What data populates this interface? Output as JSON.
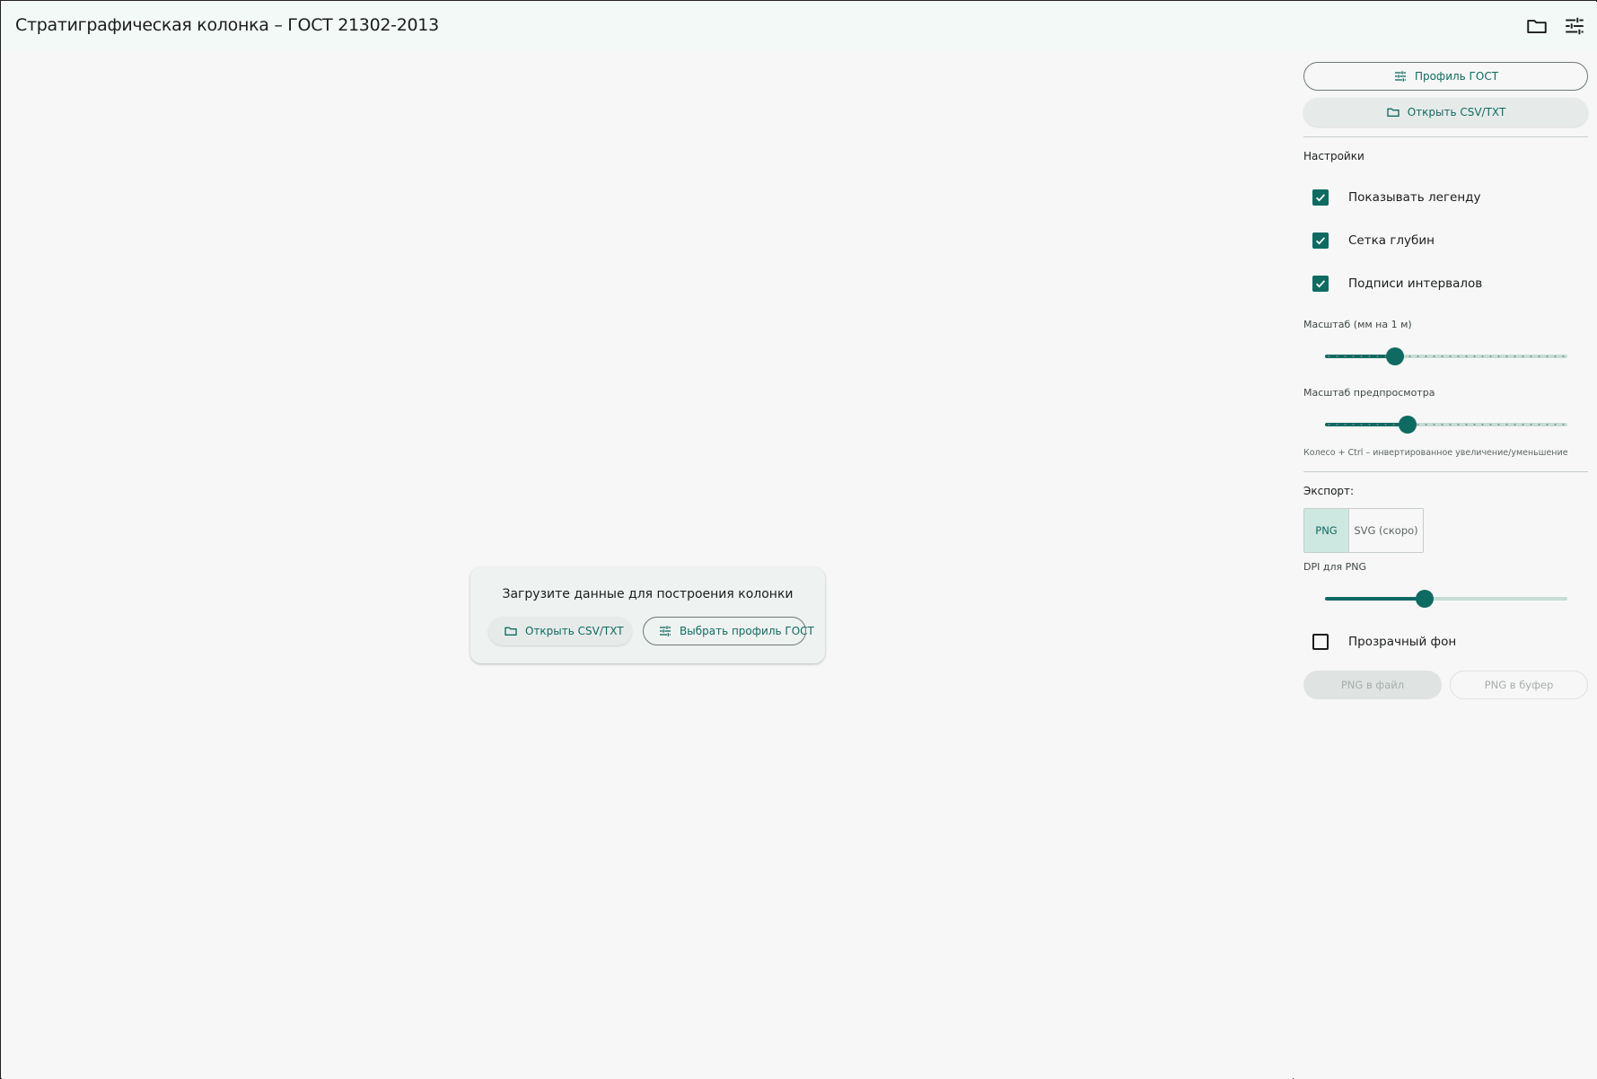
{
  "app": {
    "title": "Стратиграфическая колонка – ГОСТ 21302-2013",
    "actions": [
      {
        "name": "open-folder",
        "icon": "folder-icon"
      },
      {
        "name": "profile-settings",
        "icon": "tune-icon"
      }
    ]
  },
  "empty_state": {
    "title": "Загрузите данные для построения колонки",
    "open_label": "Открыть CSV/TXT",
    "profile_label": "Выбрать профиль ГОСТ"
  },
  "sidebar": {
    "profile_button": "Профиль ГОСТ",
    "open_button": "Открыть CSV/TXT",
    "settings_label": "Настройки",
    "checkboxes": [
      {
        "label": "Показывать легенду",
        "checked": true
      },
      {
        "label": "Сетка глубин",
        "checked": true
      },
      {
        "label": "Подписи интервалов",
        "checked": true
      }
    ],
    "scale_label": "Масштаб (мм на 1 м)",
    "scale_value": 0.29,
    "preview_scale_label": "Масштаб предпросмотра",
    "preview_scale_value": 0.34,
    "hint": "Колесо + Ctrl – инвертированное увеличение/уменьшение",
    "export_label": "Экспорт:",
    "export_formats": [
      {
        "label": "PNG",
        "selected": true
      },
      {
        "label": "SVG (скоро)",
        "selected": false
      }
    ],
    "dpi_label": "DPI для PNG",
    "dpi_value": 0.41,
    "transparent_label": "Прозрачный фон",
    "transparent_checked": false,
    "png_file_button": "PNG в файл",
    "png_clipboard_button": "PNG в буфер"
  },
  "colors": {
    "primary": "#0f6b62",
    "appbar_bg": "#f3f9f7",
    "surface": "#f6f7f6",
    "slider_inactive": "#c8dcd7",
    "disabled_text": "#a7aeab"
  }
}
